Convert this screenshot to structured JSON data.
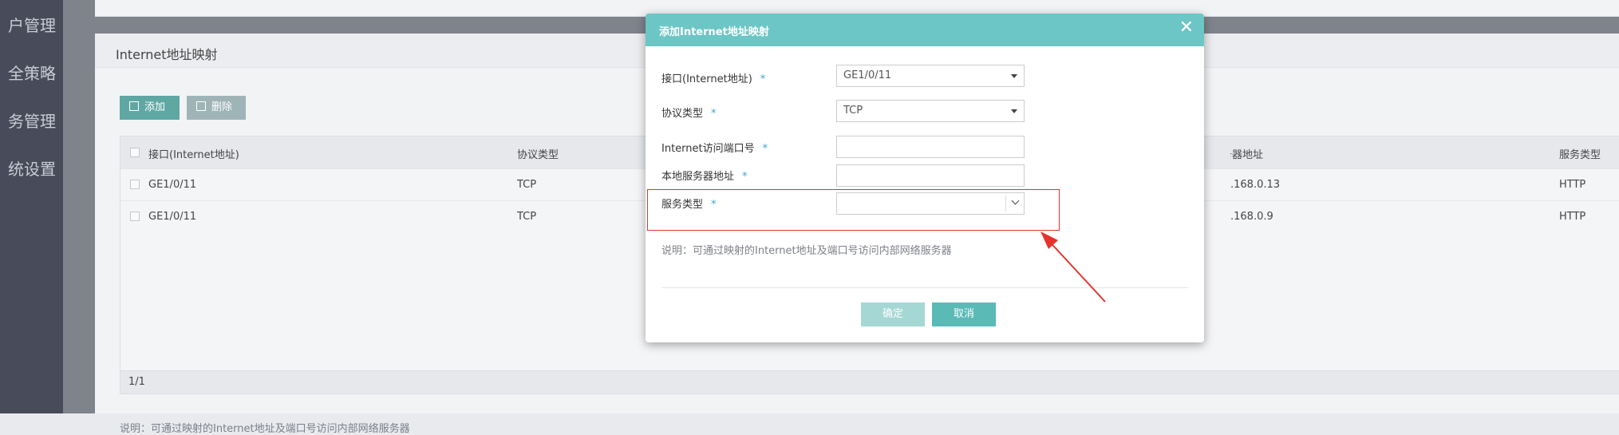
{
  "sidebar": {
    "items": [
      {
        "label": "户管理"
      },
      {
        "label": "全策略"
      },
      {
        "label": "务管理"
      },
      {
        "label": "统设置"
      }
    ]
  },
  "panel": {
    "title": "Internet地址映射",
    "add_label": "添加",
    "delete_label": "删除",
    "table": {
      "headers": [
        "接口(Internet地址)",
        "协议类型",
        "本地服务器地址",
        "服务类型"
      ],
      "rows": [
        {
          "interface": "GE1/0/11",
          "protocol": "TCP",
          "server": ".168.0.13",
          "service": "HTTP"
        },
        {
          "interface": "GE1/0/11",
          "protocol": "TCP",
          "server": ".168.0.9",
          "service": "HTTP"
        }
      ],
      "pagination": "1/1"
    },
    "note": "说明：可通过映射的Internet地址及端口号访问内部网络服务器"
  },
  "modal": {
    "title": "添加Internet地址映射",
    "close": "✕",
    "fields": {
      "interface": {
        "label": "接口(Internet地址)",
        "value": "GE1/0/11"
      },
      "protocol": {
        "label": "协议类型",
        "value": "TCP"
      },
      "port": {
        "label": "Internet访问端口号",
        "value": ""
      },
      "server": {
        "label": "本地服务器地址",
        "value": ""
      },
      "service": {
        "label": "服务类型",
        "value": ""
      }
    },
    "required_mark": "*",
    "note": "说明：可通过映射的Internet地址及端口号访问内部网络服务器",
    "ok_label": "确定",
    "cancel_label": "取消"
  },
  "colors": {
    "accent": "#6cc6c5",
    "highlight": "#e5332c",
    "required": "#3aa6d0"
  },
  "icons": [
    "close-icon",
    "add-icon",
    "delete-icon",
    "chevron-down-icon",
    "dropdown-caret-icon",
    "annotation-arrow"
  ]
}
